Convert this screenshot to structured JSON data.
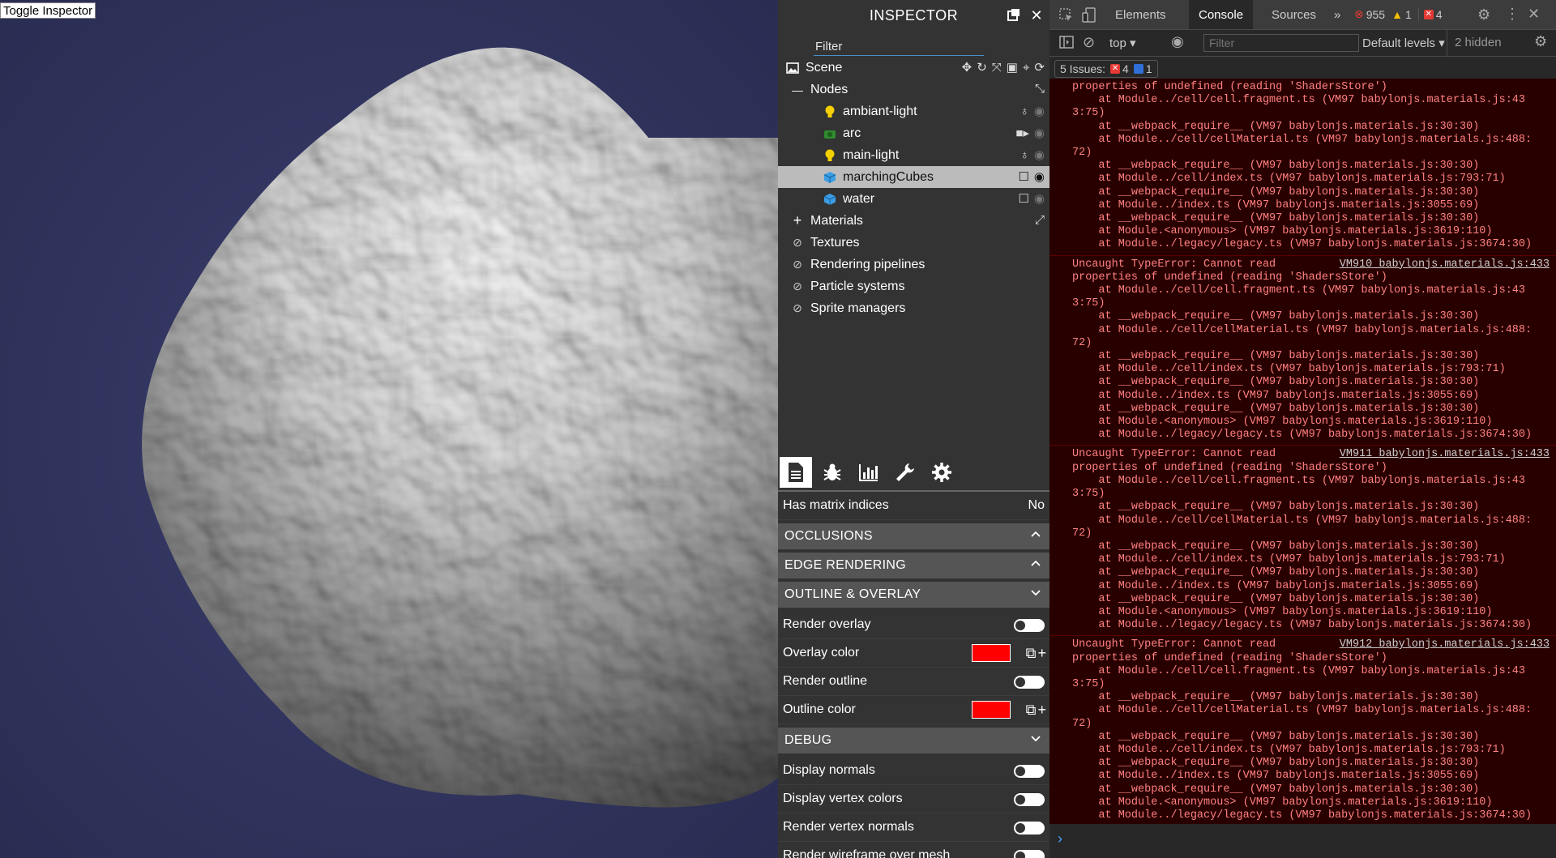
{
  "viewport": {
    "toggle_label": "Toggle Inspector"
  },
  "inspector": {
    "title": "INSPECTOR",
    "filter_placeholder": "Filter",
    "scene_label": "Scene",
    "nodes_label": "Nodes",
    "nodes": [
      {
        "label": "ambiant-light",
        "icon": "bulb-icon"
      },
      {
        "label": "arc",
        "icon": "camera-icon"
      },
      {
        "label": "main-light",
        "icon": "bulb-icon"
      },
      {
        "label": "marchingCubes",
        "icon": "mesh-cube-icon",
        "selected": true
      },
      {
        "label": "water",
        "icon": "mesh-cube-icon"
      }
    ],
    "categories": [
      "Materials",
      "Textures",
      "Rendering pipelines",
      "Particle systems",
      "Sprite managers"
    ],
    "props": {
      "has_matrix_label": "Has matrix indices",
      "has_matrix_value": "No"
    },
    "sections": {
      "occlusions": "OCCLUSIONS",
      "edge_rendering": "EDGE RENDERING",
      "outline_overlay": "OUTLINE & OVERLAY",
      "debug": "DEBUG"
    },
    "outline": {
      "render_overlay": "Render overlay",
      "overlay_color": "Overlay color",
      "render_outline": "Render outline",
      "outline_color": "Outline color"
    },
    "debug": {
      "display_normals": "Display normals",
      "display_vertex_colors": "Display vertex colors",
      "render_vertex_normals": "Render vertex normals",
      "render_wireframe": "Render wireframe over mesh"
    },
    "colors": {
      "overlay": "#ff0000",
      "outline": "#ff0000"
    }
  },
  "devtools": {
    "tabs": [
      "Elements",
      "Console",
      "Sources"
    ],
    "more": "»",
    "error_count": "955",
    "warning_count": "1",
    "issue_count": "4",
    "context": "top",
    "filter_placeholder": "Filter",
    "levels": "Default levels",
    "hidden": "2 hidden",
    "issues_label": "5 Issues:",
    "issues_errors": "4",
    "issues_info": "1",
    "first_err_tail": [
      "properties of undefined (reading 'ShadersStore')",
      "    at Module../cell/cell.fragment.ts (VM97 babylonjs.materials.js:43",
      "3:75)",
      "    at __webpack_require__ (VM97 babylonjs.materials.js:30:30)",
      "    at Module../cell/cellMaterial.ts (VM97 babylonjs.materials.js:488:",
      "72)",
      "    at __webpack_require__ (VM97 babylonjs.materials.js:30:30)",
      "    at Module../cell/index.ts (VM97 babylonjs.materials.js:793:71)",
      "    at __webpack_require__ (VM97 babylonjs.materials.js:30:30)",
      "    at Module../index.ts (VM97 babylonjs.materials.js:3055:69)",
      "    at __webpack_require__ (VM97 babylonjs.materials.js:30:30)",
      "    at Module.<anonymous> (VM97 babylonjs.materials.js:3619:110)",
      "    at Module../legacy/legacy.ts (VM97 babylonjs.materials.js:3674:30)"
    ],
    "errors": [
      {
        "source": "VM910 babylonjs.materials.js:433",
        "lines": [
          "Uncaught TypeError: Cannot read",
          "properties of undefined (reading 'ShadersStore')",
          "    at Module../cell/cell.fragment.ts (VM97 babylonjs.materials.js:43",
          "3:75)",
          "    at __webpack_require__ (VM97 babylonjs.materials.js:30:30)",
          "    at Module../cell/cellMaterial.ts (VM97 babylonjs.materials.js:488:",
          "72)",
          "    at __webpack_require__ (VM97 babylonjs.materials.js:30:30)",
          "    at Module../cell/index.ts (VM97 babylonjs.materials.js:793:71)",
          "    at __webpack_require__ (VM97 babylonjs.materials.js:30:30)",
          "    at Module../index.ts (VM97 babylonjs.materials.js:3055:69)",
          "    at __webpack_require__ (VM97 babylonjs.materials.js:30:30)",
          "    at Module.<anonymous> (VM97 babylonjs.materials.js:3619:110)",
          "    at Module../legacy/legacy.ts (VM97 babylonjs.materials.js:3674:30)"
        ]
      },
      {
        "source": "VM911 babylonjs.materials.js:433",
        "lines": [
          "Uncaught TypeError: Cannot read",
          "properties of undefined (reading 'ShadersStore')",
          "    at Module../cell/cell.fragment.ts (VM97 babylonjs.materials.js:43",
          "3:75)",
          "    at __webpack_require__ (VM97 babylonjs.materials.js:30:30)",
          "    at Module../cell/cellMaterial.ts (VM97 babylonjs.materials.js:488:",
          "72)",
          "    at __webpack_require__ (VM97 babylonjs.materials.js:30:30)",
          "    at Module../cell/index.ts (VM97 babylonjs.materials.js:793:71)",
          "    at __webpack_require__ (VM97 babylonjs.materials.js:30:30)",
          "    at Module../index.ts (VM97 babylonjs.materials.js:3055:69)",
          "    at __webpack_require__ (VM97 babylonjs.materials.js:30:30)",
          "    at Module.<anonymous> (VM97 babylonjs.materials.js:3619:110)",
          "    at Module../legacy/legacy.ts (VM97 babylonjs.materials.js:3674:30)"
        ]
      },
      {
        "source": "VM912 babylonjs.materials.js:433",
        "lines": [
          "Uncaught TypeError: Cannot read",
          "properties of undefined (reading 'ShadersStore')",
          "    at Module../cell/cell.fragment.ts (VM97 babylonjs.materials.js:43",
          "3:75)",
          "    at __webpack_require__ (VM97 babylonjs.materials.js:30:30)",
          "    at Module../cell/cellMaterial.ts (VM97 babylonjs.materials.js:488:",
          "72)",
          "    at __webpack_require__ (VM97 babylonjs.materials.js:30:30)",
          "    at Module../cell/index.ts (VM97 babylonjs.materials.js:793:71)",
          "    at __webpack_require__ (VM97 babylonjs.materials.js:30:30)",
          "    at Module../index.ts (VM97 babylonjs.materials.js:3055:69)",
          "    at __webpack_require__ (VM97 babylonjs.materials.js:30:30)",
          "    at Module.<anonymous> (VM97 babylonjs.materials.js:3619:110)",
          "    at Module../legacy/legacy.ts (VM97 babylonjs.materials.js:3674:30)"
        ]
      }
    ],
    "prompt": "›"
  }
}
